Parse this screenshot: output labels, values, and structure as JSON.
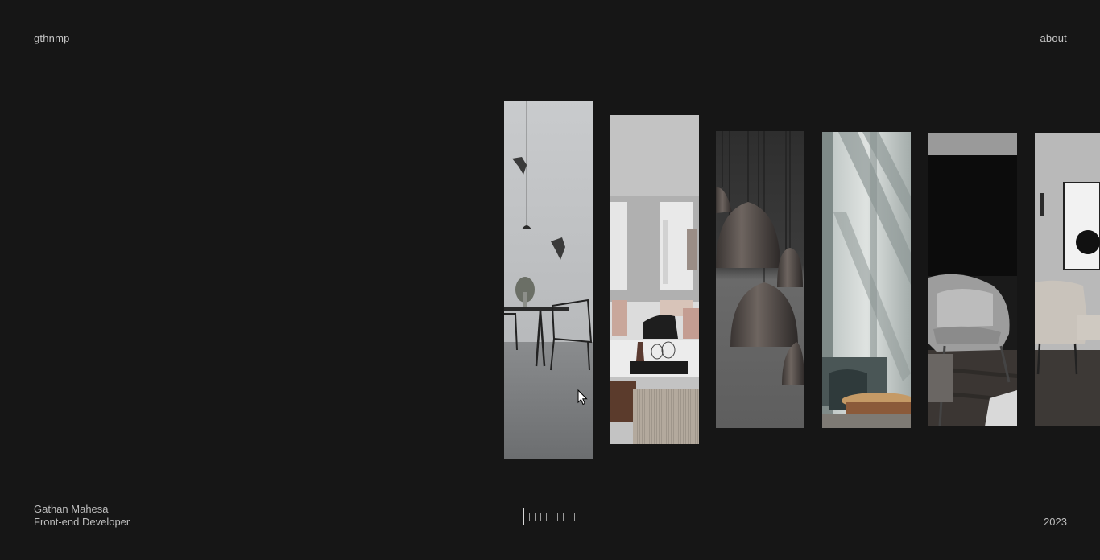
{
  "header": {
    "brand": "gthnmp —",
    "about_link": "— about"
  },
  "gallery": {
    "panels": [
      {
        "name": "dining-room-panel",
        "icon": "dining-room-image"
      },
      {
        "name": "living-room-panel",
        "icon": "living-room-image"
      },
      {
        "name": "pendant-lamps-panel",
        "icon": "pendant-lamps-image"
      },
      {
        "name": "window-light-panel",
        "icon": "window-shadow-image"
      },
      {
        "name": "armchair-panel",
        "icon": "armchair-image"
      },
      {
        "name": "lounge-chair-panel",
        "icon": "lounge-chair-image"
      }
    ]
  },
  "footer": {
    "name": "Gathan Mahesa",
    "role": "Front-end Developer",
    "year": "2023",
    "progress_ticks": 10,
    "active_tick": 1
  },
  "colors": {
    "background": "#161616",
    "text": "#bdbdbd"
  }
}
